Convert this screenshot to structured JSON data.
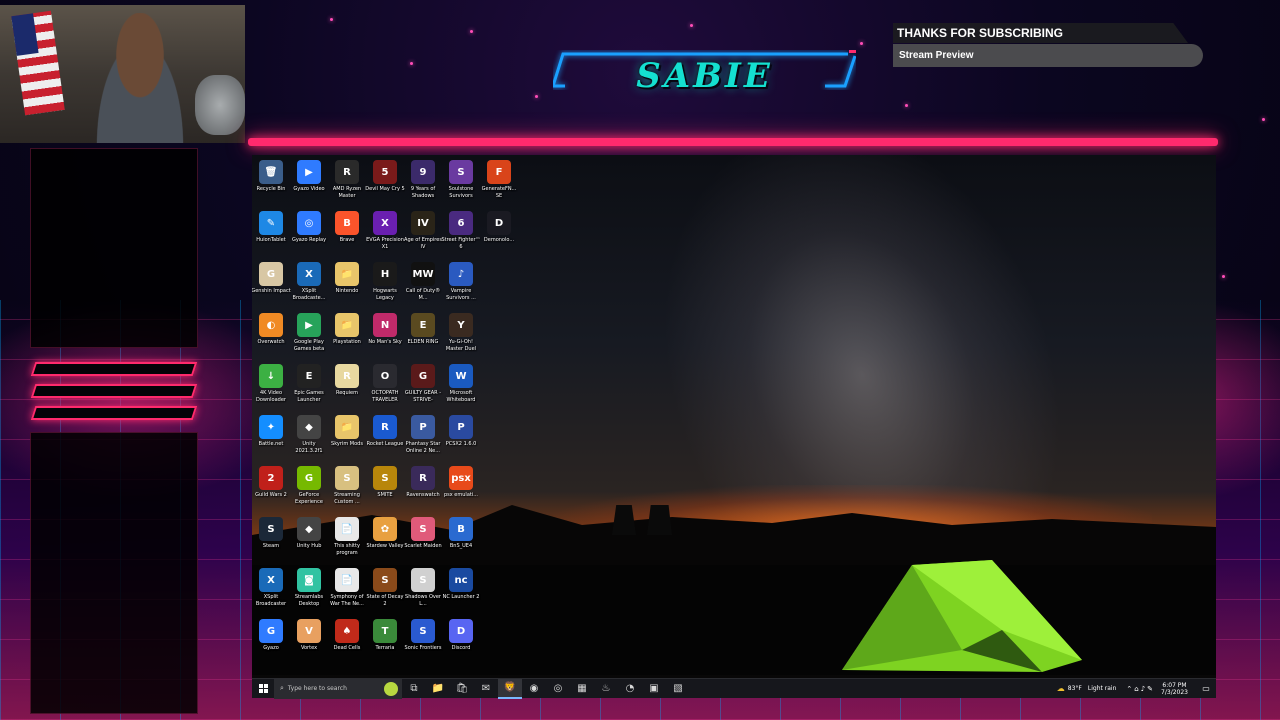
{
  "overlay": {
    "logo_text": "SABIE",
    "subscribe_title": "THANKS FOR SUBSCRIBING",
    "subscribe_subtitle": "Stream Preview"
  },
  "desktop": {
    "icons": [
      {
        "label": "Recycle Bin",
        "glyph": "🗑",
        "color": "#3a5d8a"
      },
      {
        "label": "Gyazo Video",
        "glyph": "▶",
        "color": "#2f7bff"
      },
      {
        "label": "AMD Ryzen Master",
        "glyph": "R",
        "color": "#2a2a2a"
      },
      {
        "label": "Devil May Cry 5",
        "glyph": "5",
        "color": "#7a1a1a"
      },
      {
        "label": "9 Years of Shadows",
        "glyph": "9",
        "color": "#3b2a6a"
      },
      {
        "label": "Soulstone Survivors",
        "glyph": "S",
        "color": "#6a3aa0"
      },
      {
        "label": "GenerateFN... SE",
        "glyph": "F",
        "color": "#d9441a"
      },
      {
        "label": "HuionTablet",
        "glyph": "✎",
        "color": "#1e88e5"
      },
      {
        "label": "Gyazo Replay",
        "glyph": "◎",
        "color": "#2f7bff"
      },
      {
        "label": "Brave",
        "glyph": "B",
        "color": "#fb542b"
      },
      {
        "label": "EVGA Precision X1",
        "glyph": "X",
        "color": "#6a1fb0"
      },
      {
        "label": "Age of Empires IV",
        "glyph": "IV",
        "color": "#2a2418"
      },
      {
        "label": "Street Fighter™ 6",
        "glyph": "6",
        "color": "#4a2a80"
      },
      {
        "label": "Demonolo...",
        "glyph": "D",
        "color": "#1a1a22"
      },
      {
        "label": "Genshin Impact",
        "glyph": "G",
        "color": "#d8c7a4"
      },
      {
        "label": "XSplit Broadcaste...",
        "glyph": "X",
        "color": "#1a6ab8"
      },
      {
        "label": "Nintendo",
        "glyph": "📁",
        "color": "#e8c56a"
      },
      {
        "label": "Hogwarts Legacy",
        "glyph": "H",
        "color": "#1a1a1a"
      },
      {
        "label": "Call of Duty® M...",
        "glyph": "MW",
        "color": "#111111"
      },
      {
        "label": "Vampire Survivors ...",
        "glyph": "♪",
        "color": "#2a5ac0"
      },
      {
        "label": "",
        "glyph": "",
        "color": "transparent"
      },
      {
        "label": "Overwatch",
        "glyph": "◐",
        "color": "#f08a24"
      },
      {
        "label": "Google Play Games beta",
        "glyph": "▶",
        "color": "#27a35a"
      },
      {
        "label": "Playstation",
        "glyph": "📁",
        "color": "#e8c56a"
      },
      {
        "label": "No Man's Sky",
        "glyph": "N",
        "color": "#c02a6a"
      },
      {
        "label": "ELDEN RING",
        "glyph": "E",
        "color": "#5a4a20"
      },
      {
        "label": "Yu-Gi-Oh! Master Duel",
        "glyph": "Y",
        "color": "#3a2a20"
      },
      {
        "label": "",
        "glyph": "",
        "color": "transparent"
      },
      {
        "label": "4K Video Downloader",
        "glyph": "↓",
        "color": "#3cb043"
      },
      {
        "label": "Epic Games Launcher",
        "glyph": "E",
        "color": "#222222"
      },
      {
        "label": "Requiem",
        "glyph": "R",
        "color": "#e8d8a0"
      },
      {
        "label": "OCTOPATH TRAVELER",
        "glyph": "O",
        "color": "#2a2a30"
      },
      {
        "label": "GUILTY GEAR -STRIVE-",
        "glyph": "G",
        "color": "#5a1a1a"
      },
      {
        "label": "Microsoft Whiteboard",
        "glyph": "W",
        "color": "#1a5ac0"
      },
      {
        "label": "",
        "glyph": "",
        "color": "transparent"
      },
      {
        "label": "Battle.net",
        "glyph": "✦",
        "color": "#148eff"
      },
      {
        "label": "Unity 2021.3.2f1",
        "glyph": "◆",
        "color": "#444444"
      },
      {
        "label": "Skyrim Mods",
        "glyph": "📁",
        "color": "#e8c56a"
      },
      {
        "label": "Rocket League",
        "glyph": "R",
        "color": "#1a5ad0"
      },
      {
        "label": "Phantasy Star Online 2 Ne...",
        "glyph": "P",
        "color": "#3a5aa0"
      },
      {
        "label": "PCSX2 1.6.0",
        "glyph": "P",
        "color": "#2a4aa0"
      },
      {
        "label": "",
        "glyph": "",
        "color": "transparent"
      },
      {
        "label": "Guild Wars 2",
        "glyph": "2",
        "color": "#c0201a"
      },
      {
        "label": "GeForce Experience",
        "glyph": "G",
        "color": "#76b900"
      },
      {
        "label": "Streaming Custom ...",
        "glyph": "S",
        "color": "#d8c080"
      },
      {
        "label": "SMITE",
        "glyph": "S",
        "color": "#b8860b"
      },
      {
        "label": "Ravenswatch",
        "glyph": "R",
        "color": "#3a2a5a"
      },
      {
        "label": "psx emulati...",
        "glyph": "psx",
        "color": "#e84a1a"
      },
      {
        "label": "",
        "glyph": "",
        "color": "transparent"
      },
      {
        "label": "Steam",
        "glyph": "S",
        "color": "#1b2838"
      },
      {
        "label": "Unity Hub",
        "glyph": "◆",
        "color": "#444444"
      },
      {
        "label": "This shitty program",
        "glyph": "📄",
        "color": "#e8e8e8"
      },
      {
        "label": "Stardew Valley",
        "glyph": "✿",
        "color": "#e8a040"
      },
      {
        "label": "Scarlet Maiden",
        "glyph": "S",
        "color": "#e05a7a"
      },
      {
        "label": "BnS_UE4",
        "glyph": "B",
        "color": "#2a6ad0"
      },
      {
        "label": "",
        "glyph": "",
        "color": "transparent"
      },
      {
        "label": "XSplit Broadcaster",
        "glyph": "X",
        "color": "#1a6ab8"
      },
      {
        "label": "Streamlabs Desktop",
        "glyph": "◙",
        "color": "#31c3a2"
      },
      {
        "label": "Symphony of War The Ne...",
        "glyph": "📄",
        "color": "#e8e8e8"
      },
      {
        "label": "State of Decay 2",
        "glyph": "S",
        "color": "#8a4a1a"
      },
      {
        "label": "Shadows Over L...",
        "glyph": "S",
        "color": "#d0d0d0"
      },
      {
        "label": "NC Launcher 2",
        "glyph": "nc",
        "color": "#1a4aa0"
      },
      {
        "label": "",
        "glyph": "",
        "color": "transparent"
      },
      {
        "label": "Gyazo",
        "glyph": "G",
        "color": "#2f7bff"
      },
      {
        "label": "Vortex",
        "glyph": "V",
        "color": "#e8a060"
      },
      {
        "label": "Dead Cells",
        "glyph": "♠",
        "color": "#c02a1a"
      },
      {
        "label": "Terraria",
        "glyph": "T",
        "color": "#3a8a3a"
      },
      {
        "label": "Sonic Frontiers",
        "glyph": "S",
        "color": "#2a5ad0"
      },
      {
        "label": "Discord",
        "glyph": "D",
        "color": "#5865f2"
      }
    ]
  },
  "taskbar": {
    "search_placeholder": "Type here to search",
    "apps": [
      {
        "name": "task-view",
        "glyph": "⧉",
        "active": false
      },
      {
        "name": "file-explorer",
        "glyph": "📁",
        "active": false
      },
      {
        "name": "store",
        "glyph": "🛍",
        "active": false
      },
      {
        "name": "mail",
        "glyph": "✉",
        "active": false
      },
      {
        "name": "brave",
        "glyph": "🦁",
        "active": true
      },
      {
        "name": "chrome",
        "glyph": "◉",
        "active": false
      },
      {
        "name": "gyazo",
        "glyph": "◎",
        "active": false
      },
      {
        "name": "minecraft",
        "glyph": "▦",
        "active": false
      },
      {
        "name": "steam",
        "glyph": "♨",
        "active": false
      },
      {
        "name": "discord",
        "glyph": "◔",
        "active": false
      },
      {
        "name": "app-brown",
        "glyph": "▣",
        "active": false
      },
      {
        "name": "xsplit",
        "glyph": "▧",
        "active": false
      }
    ],
    "weather_temp": "83°F",
    "weather_desc": "Light rain",
    "time": "6:07 PM",
    "date": "7/3/2023"
  },
  "colors": {
    "neon_pink": "#ff2a6d",
    "neon_cyan": "#14e0d0",
    "neon_blue": "#1aa0ff"
  }
}
